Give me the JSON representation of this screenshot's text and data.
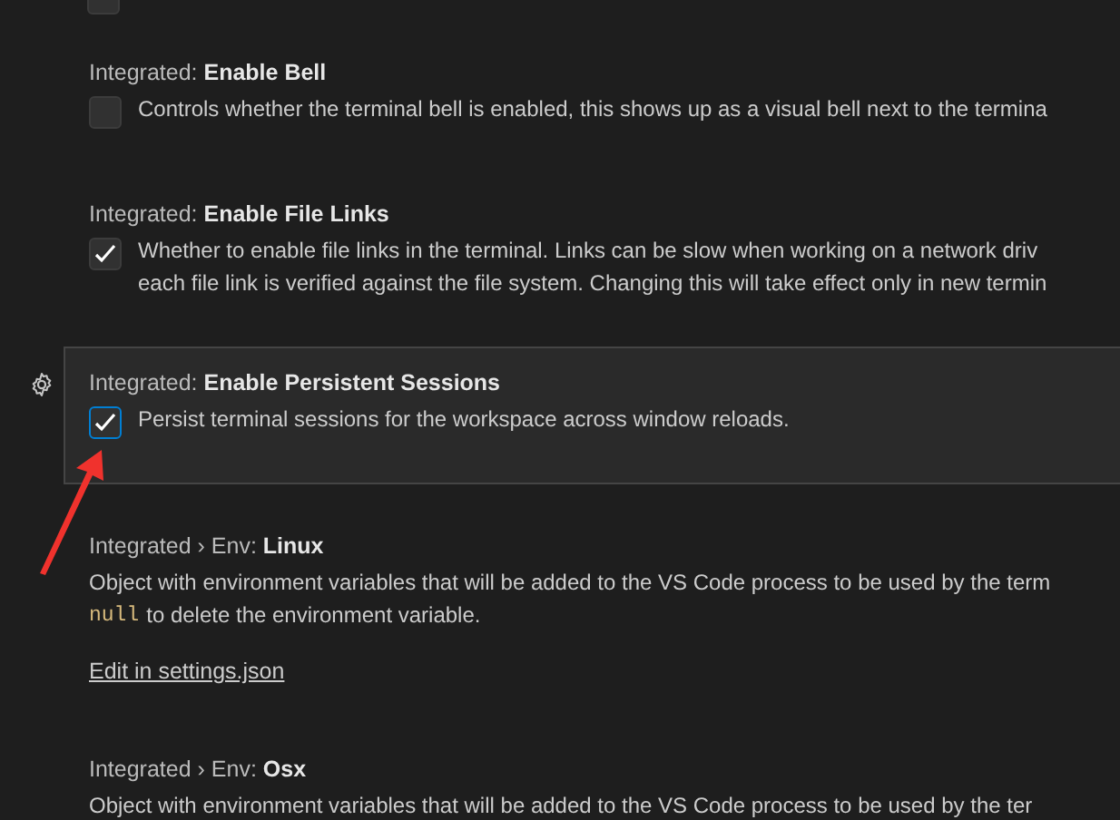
{
  "partial_setting": {
    "checked": false
  },
  "settings": [
    {
      "kind": "checkbox",
      "title": "Integrated: **Enable Bell**",
      "checked": false,
      "focused": false,
      "description": [
        "Controls whether the terminal bell is enabled, this shows up as a visual bell next to the termina"
      ]
    },
    {
      "kind": "checkbox",
      "title": "Integrated: **Enable File Links**",
      "checked": true,
      "focused": false,
      "description": [
        "Whether to enable file links in the terminal. Links can be slow when working on a network driv",
        "each file link is verified against the file system. Changing this will take effect only in new termin"
      ]
    },
    {
      "kind": "checkbox",
      "title": "Integrated: **Enable Persistent Sessions**",
      "checked": true,
      "focused": true,
      "description": [
        "Persist terminal sessions for the workspace across window reloads."
      ]
    },
    {
      "kind": "object",
      "title": "Integrated › Env: **Linux**",
      "focused": false,
      "description": [
        "Object with environment variables that will be added to the VS Code process to be used by the term"
      ],
      "code": "null",
      "code_suffix": "to delete the environment variable.",
      "link": "Edit in settings.json"
    },
    {
      "kind": "object",
      "title": "Integrated › Env: **Osx**",
      "focused": false,
      "description": [
        "Object with environment variables that will be added to the VS Code process to be used by the ter"
      ]
    }
  ]
}
